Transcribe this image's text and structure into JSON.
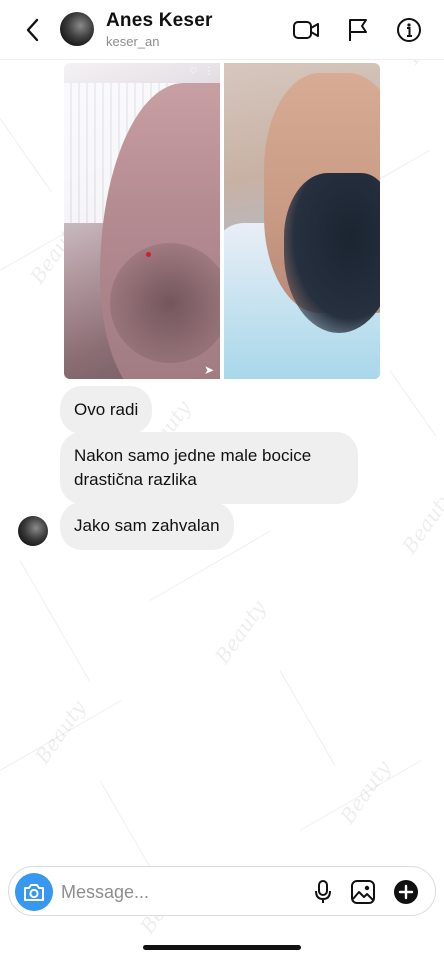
{
  "header": {
    "name": "Anes Keser",
    "username": "keser_an",
    "icons": [
      "back-chevron-icon",
      "video-call-icon",
      "flag-icon",
      "info-icon"
    ]
  },
  "messages": [
    {
      "text": "Ovo radi"
    },
    {
      "text": "Nakon samo jedne male bocice drastična razlika"
    },
    {
      "text": "Jako sam zahvalan"
    }
  ],
  "composer": {
    "placeholder": "Message...",
    "value": "",
    "icons": [
      "camera-icon",
      "microphone-icon",
      "gallery-icon",
      "add-icon"
    ]
  },
  "colors": {
    "accent": "#3897f0",
    "bubble": "#efefef",
    "muted": "#8e8e8e"
  }
}
